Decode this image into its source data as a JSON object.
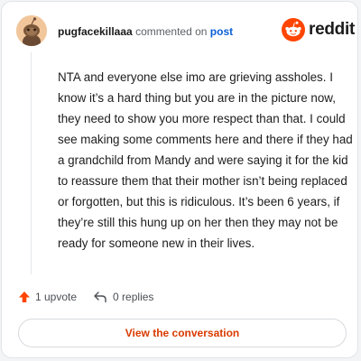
{
  "comment": {
    "username": "pugfacekillaaa",
    "action_text": "commented on",
    "post_link": "post",
    "body": "NTA and everyone else imo are grieving assholes. I know it’s a hard thing but you are in the picture now, they need to show you more respect than that. I could see making some comments here and there if they had a grandchild from Mandy and were saying it for the kid to reassure them that their mother isn’t being replaced or forgotten, but this is ridiculous. It’s been 6 years, if they’re still this hung up on her then they may not be ready for someone new in their lives."
  },
  "brand": {
    "wordmark": "reddit",
    "icon": "reddit-snoo-icon"
  },
  "stats": {
    "upvotes": "1 upvote",
    "upvote_icon": "upvote-arrow-icon",
    "replies": "0 replies",
    "reply_icon": "reply-arrow-icon"
  },
  "actions": {
    "view_conversation": "View the conversation"
  },
  "colors": {
    "reddit_orange": "#ff4500",
    "link_blue": "#0a5fd6",
    "button_text": "#d93a00"
  }
}
